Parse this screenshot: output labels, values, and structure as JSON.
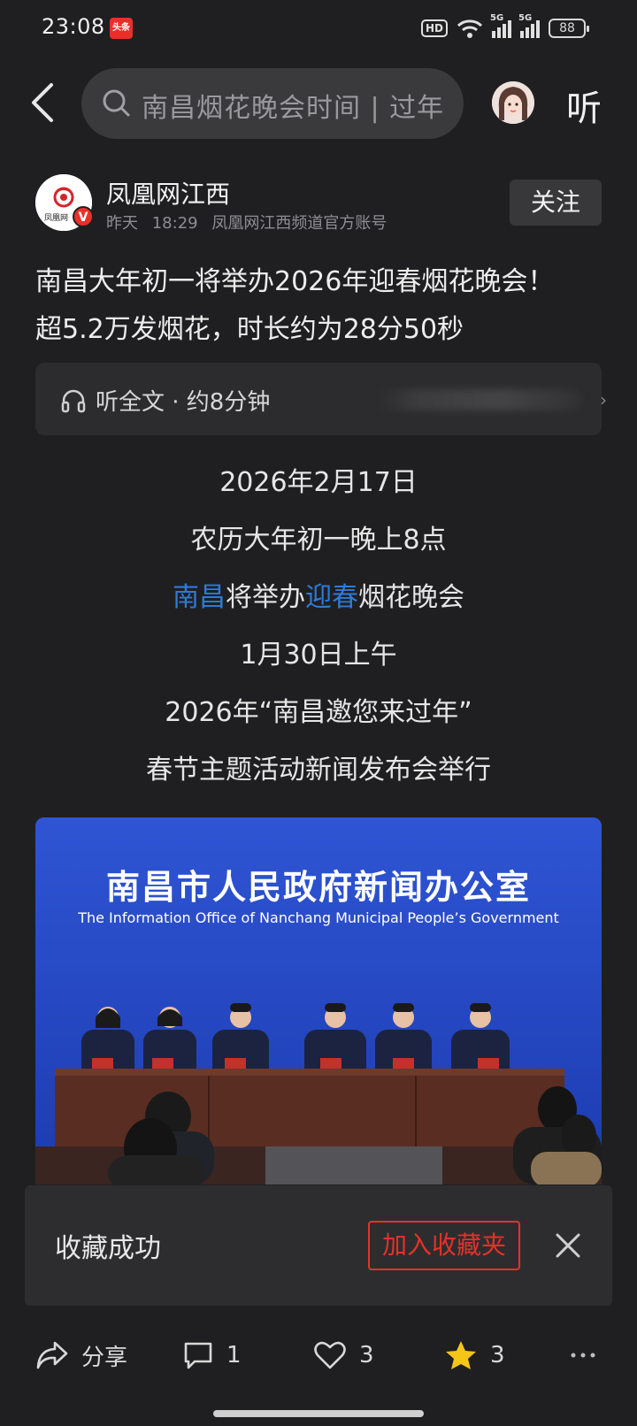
{
  "status_bar": {
    "time": "23:08",
    "app_badge": "头条",
    "hd": "HD",
    "signal1": "5G",
    "signal2": "5G",
    "battery": "88"
  },
  "search": {
    "placeholder": "南昌烟花晚会时间 | 过年"
  },
  "nav": {
    "listen_label": "听"
  },
  "author": {
    "name": "凤凰网江西",
    "logo_text": "凤凰网",
    "verified": "V",
    "date": "昨天",
    "time": "18:29",
    "description": "凤凰网江西频道官方账号",
    "follow_label": "关注"
  },
  "article": {
    "title_line1": "南昌大年初一将举办2026年迎春烟花晚会！",
    "title_line2": "超5.2万发烟花，时长约为28分50秒"
  },
  "listen_bar": {
    "label": "听全文 · 约8分钟"
  },
  "body": {
    "line1": "2026年2月17日",
    "line2": "农历大年初一晚上8点",
    "line3_hl1": "南昌",
    "line3_mid": "将举办",
    "line3_hl2": "迎春",
    "line3_end": "烟花晚会",
    "line4": "1月30日上午",
    "line5": "2026年“南昌邀您来过年”",
    "line6": "春节主题活动新闻发布会举行"
  },
  "photo": {
    "title": "南昌市人民政府新闻办公室",
    "subtitle": "The Information Office of Nanchang Municipal People’s Government"
  },
  "toast": {
    "message": "收藏成功",
    "add_label": "加入收藏夹"
  },
  "bottom_bar": {
    "share_label": "分享",
    "comment_count": "1",
    "like_count": "3",
    "favorite_count": "3"
  },
  "colors": {
    "accent": "#2f7ad9",
    "brand_red": "#e8302a",
    "favorite_yellow": "#f5c518",
    "background": "#1f1f21"
  }
}
